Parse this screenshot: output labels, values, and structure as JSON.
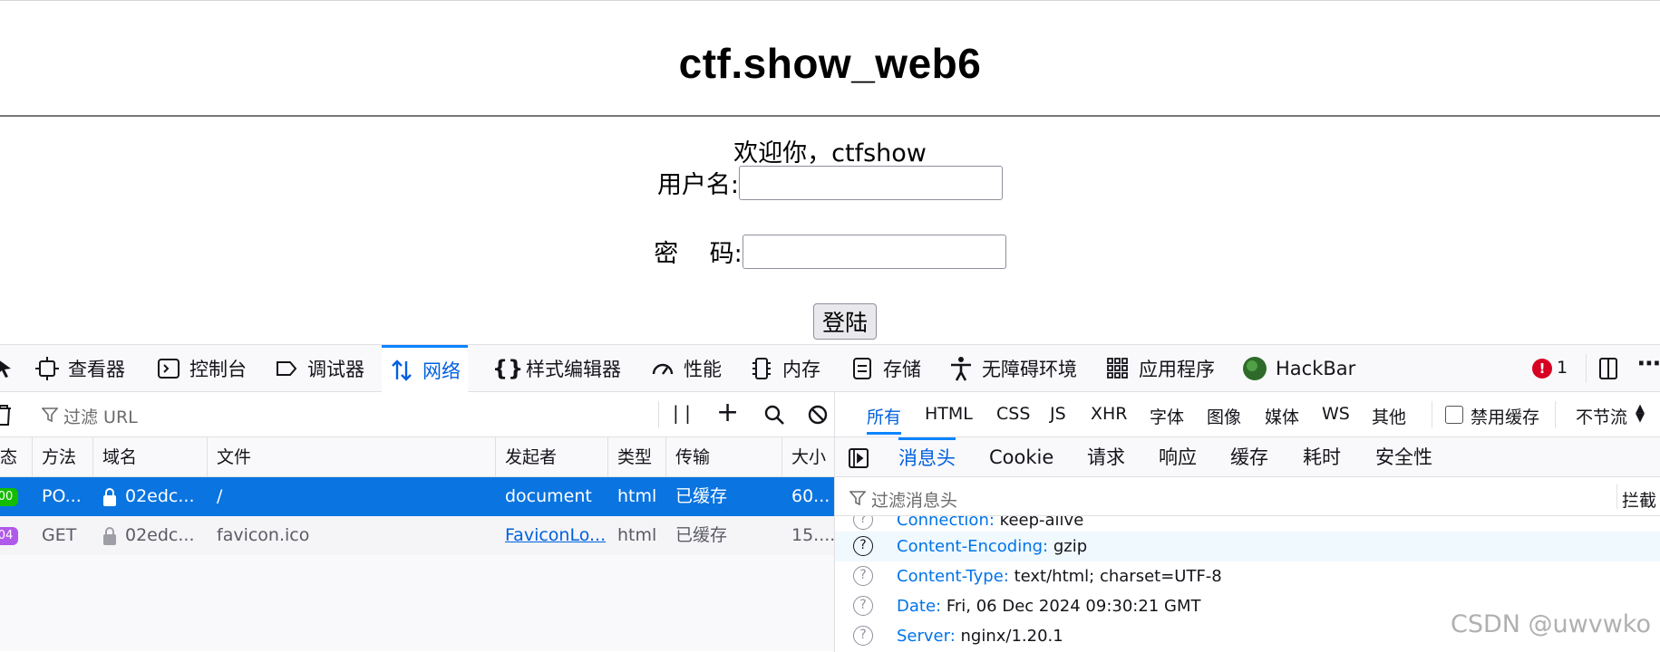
{
  "page": {
    "title": "ctf.show_web6",
    "welcome": "欢迎你，ctfshow",
    "username_label": "用户名:",
    "password_label": "密    码:",
    "username_value": "",
    "password_value": "",
    "login_label": "登陆"
  },
  "devtools": {
    "tabs": [
      {
        "label": "查看器",
        "icon": "inspector-icon"
      },
      {
        "label": "控制台",
        "icon": "console-icon"
      },
      {
        "label": "调试器",
        "icon": "debugger-icon"
      },
      {
        "label": "网络",
        "icon": "network-icon"
      },
      {
        "label": "样式编辑器",
        "icon": "style-editor-icon"
      },
      {
        "label": "性能",
        "icon": "performance-icon"
      },
      {
        "label": "内存",
        "icon": "memory-icon"
      },
      {
        "label": "存储",
        "icon": "storage-icon"
      },
      {
        "label": "无障碍环境",
        "icon": "accessibility-icon"
      },
      {
        "label": "应用程序",
        "icon": "application-icon"
      },
      {
        "label": "HackBar",
        "icon": "hackbar-icon"
      }
    ],
    "error_count": "1",
    "error_badge": "!",
    "filter_url_placeholder": "过滤 URL",
    "type_filters": [
      "所有",
      "HTML",
      "CSS",
      "JS",
      "XHR",
      "字体",
      "图像",
      "媒体",
      "WS",
      "其他"
    ],
    "disable_cache_label": "禁用缓存",
    "throttle_label": "不节流",
    "columns": [
      "态",
      "方法",
      "域名",
      "文件",
      "发起者",
      "类型",
      "传输",
      "大小"
    ],
    "requests": [
      {
        "status": "00",
        "method": "PO...",
        "domain": "02edc...",
        "file": "/",
        "initiator": "document",
        "type": "html",
        "transfer": "已缓存",
        "size": "60..."
      },
      {
        "status": "04",
        "method": "GET",
        "domain": "02edc...",
        "file": "favicon.ico",
        "initiator": "FaviconLo...",
        "type": "html",
        "transfer": "已缓存",
        "size": "15...."
      }
    ],
    "detail_tabs": [
      "消息头",
      "Cookie",
      "请求",
      "响应",
      "缓存",
      "耗时",
      "安全性"
    ],
    "headers_filter_placeholder": "过滤消息头",
    "block_label": "拦截",
    "headers": [
      {
        "key": "Connection:",
        "value": "keep-alive"
      },
      {
        "key": "Content-Encoding:",
        "value": "gzip"
      },
      {
        "key": "Content-Type:",
        "value": "text/html; charset=UTF-8"
      },
      {
        "key": "Date:",
        "value": "Fri, 06 Dec 2024 09:30:21 GMT"
      },
      {
        "key": "Server:",
        "value": "nginx/1.20.1"
      }
    ]
  },
  "watermark": "CSDN @uwvwko",
  "colors": {
    "accent": "#0a84ff",
    "selected_row": "#0a74e0",
    "status_200": "#12bc00",
    "status_304": "#b05aea",
    "error": "#d70022"
  }
}
